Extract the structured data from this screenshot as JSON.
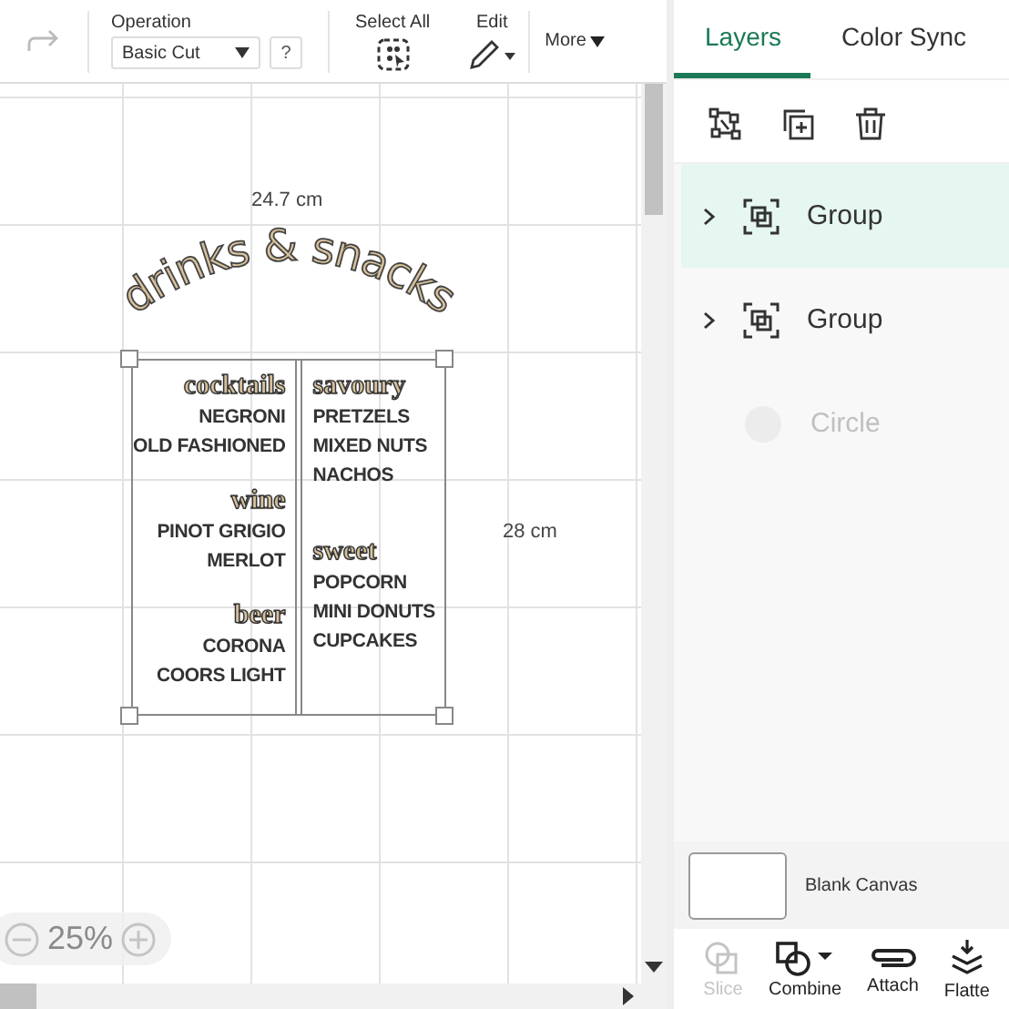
{
  "toolbar": {
    "redo": {
      "disabled": true
    },
    "operation": {
      "label": "Operation",
      "value": "Basic Cut",
      "help": "?"
    },
    "select_all": {
      "label": "Select All"
    },
    "edit": {
      "label": "Edit"
    },
    "more": {
      "label": "More"
    }
  },
  "canvas": {
    "width_label": "24.7 cm",
    "height_label": "28 cm",
    "zoom": "25%",
    "design": {
      "title": "drinks & snacks",
      "columns": [
        {
          "sections": [
            {
              "heading": "cocktails",
              "items": [
                "NEGRONI",
                "OLD FASHIONED"
              ]
            },
            {
              "heading": "wine",
              "items": [
                "PINOT GRIGIO",
                "MERLOT"
              ]
            },
            {
              "heading": "beer",
              "items": [
                "CORONA",
                "COORS LIGHT"
              ]
            }
          ]
        },
        {
          "sections": [
            {
              "heading": "savoury",
              "items": [
                "PRETZELS",
                "MIXED NUTS",
                "NACHOS"
              ]
            },
            {
              "heading": "sweet",
              "items": [
                "POPCORN",
                "MINI DONUTS",
                "CUPCAKES"
              ]
            }
          ]
        }
      ]
    }
  },
  "panel": {
    "tabs": [
      {
        "label": "Layers",
        "selected": true
      },
      {
        "label": "Color Sync",
        "selected": false
      }
    ],
    "layers": [
      {
        "name": "Group",
        "kind": "group",
        "selected": true,
        "hidden": false
      },
      {
        "name": "Group",
        "kind": "group",
        "selected": false,
        "hidden": false
      },
      {
        "name": "Circle",
        "kind": "circle",
        "selected": false,
        "hidden": true
      }
    ],
    "canvas_layer": {
      "label": "Blank Canvas"
    },
    "actions": [
      {
        "label": "Slice",
        "kind": "slice",
        "disabled": true
      },
      {
        "label": "Combine",
        "kind": "combine",
        "disabled": false
      },
      {
        "label": "Attach",
        "kind": "attach",
        "disabled": false
      },
      {
        "label": "Flatte",
        "kind": "flatten",
        "disabled": false
      }
    ]
  }
}
